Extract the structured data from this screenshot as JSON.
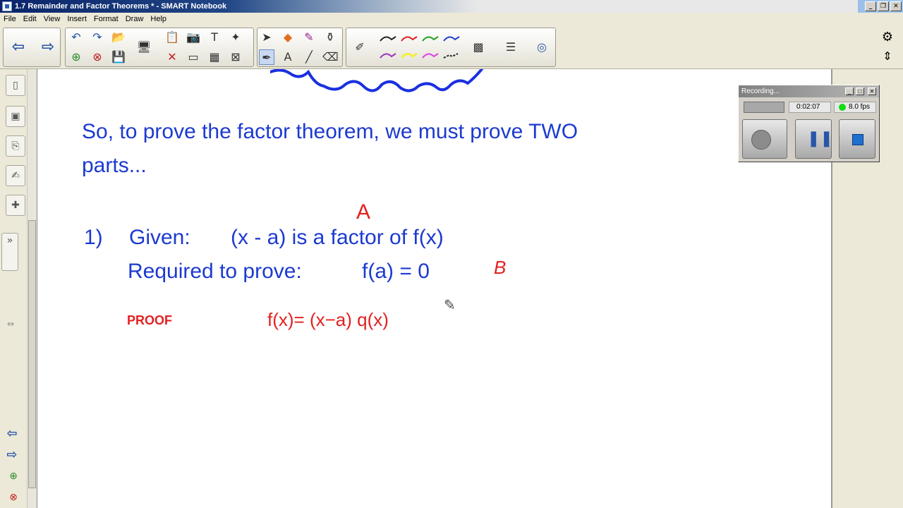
{
  "window": {
    "title": "1.7 Remainder and Factor Theorems * - SMART Notebook"
  },
  "menu": [
    "File",
    "Edit",
    "View",
    "Insert",
    "Format",
    "Draw",
    "Help"
  ],
  "page": {
    "line1": "So, to prove the factor theorem, we must prove TWO",
    "line2": "parts...",
    "item_number": "1)",
    "given_label": "Given:",
    "given_text": "(x - a) is a factor of f(x)",
    "required_label": "Required to prove:",
    "required_text": "f(a) = 0"
  },
  "annotations": {
    "label_a": "A",
    "label_b": "B",
    "proof": "PROOF",
    "equation": "f(x)=  (x−a)  q(x)"
  },
  "recorder": {
    "title": "Recording...",
    "time": "0:02:07",
    "fps": "8.0 fps"
  },
  "colors": {
    "typed_text": "#1c3ad0",
    "ink": "#e32020",
    "recording_indicator": "#11dd11"
  }
}
